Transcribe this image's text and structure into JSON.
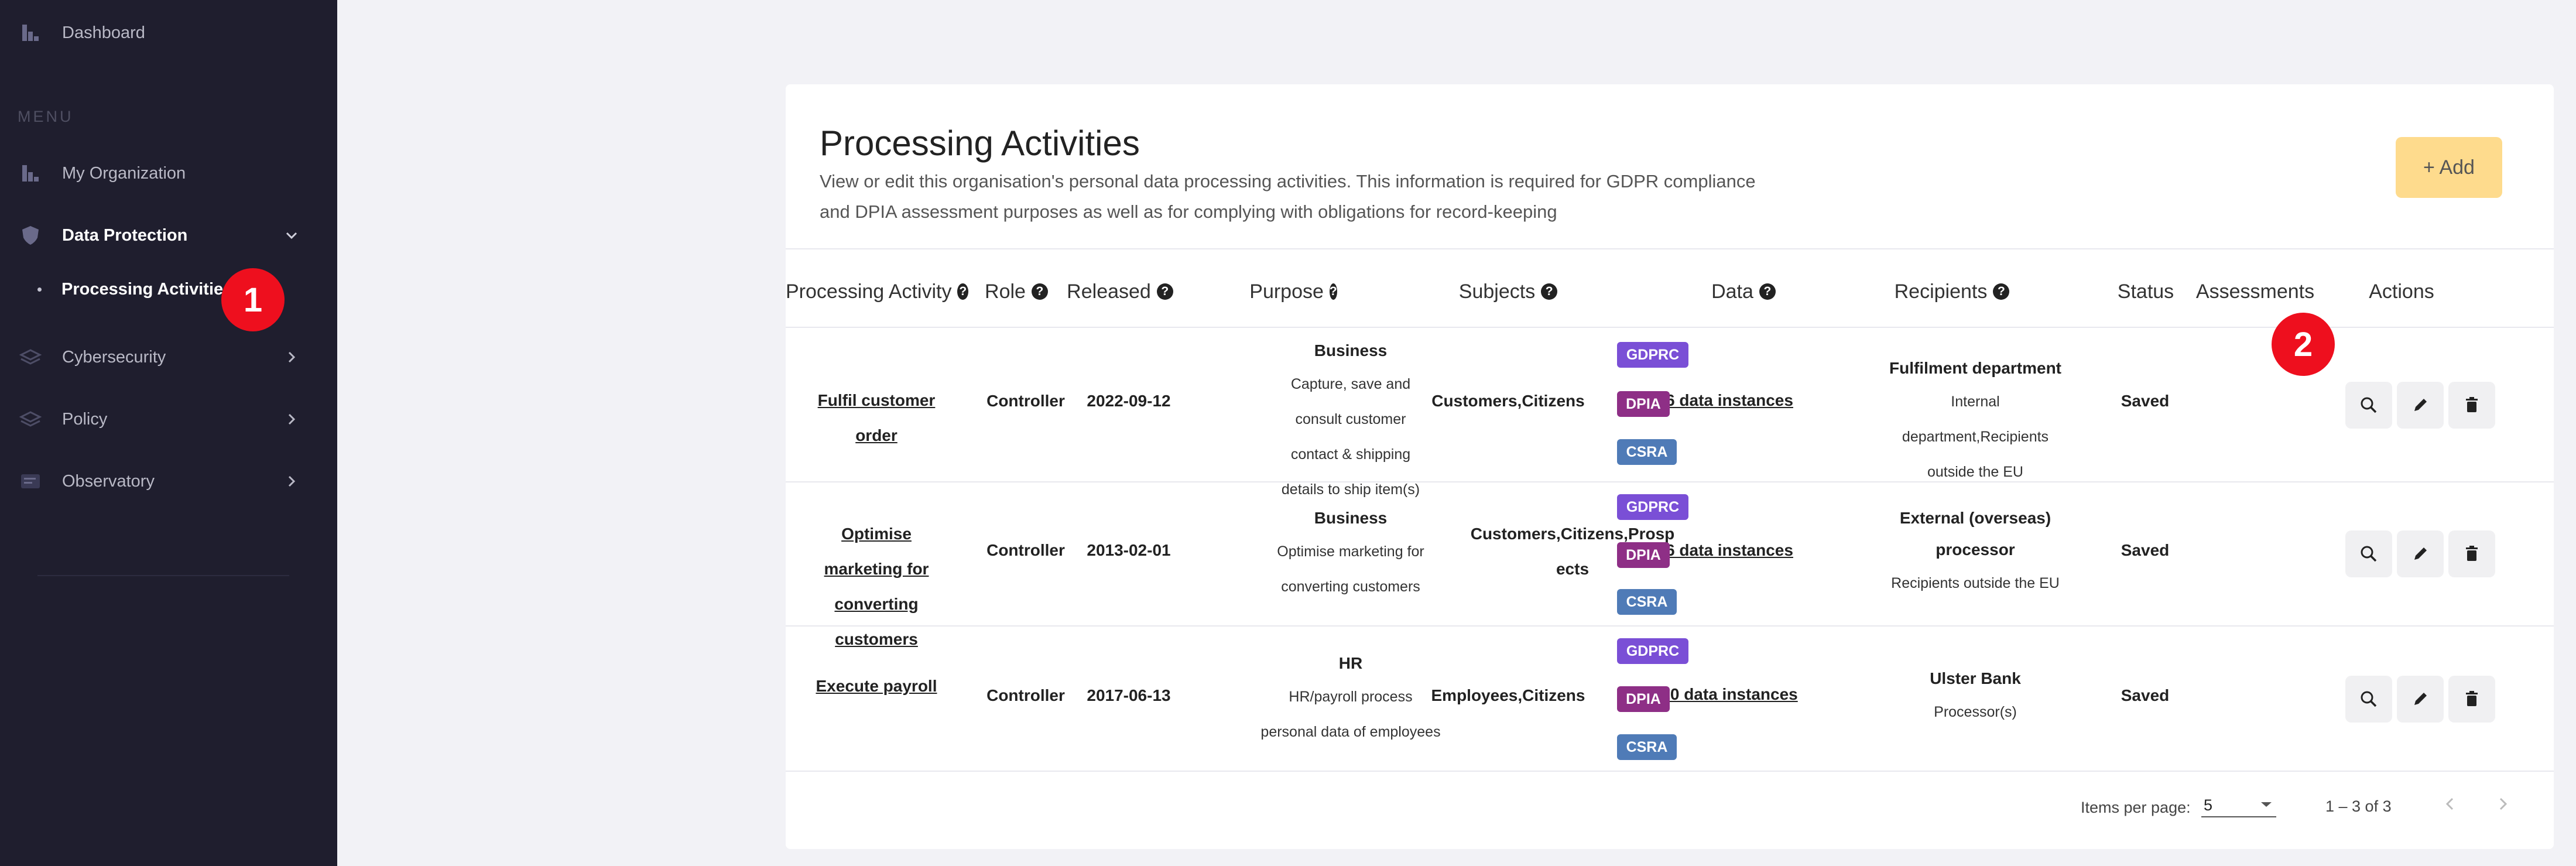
{
  "sidebar": {
    "dashboard": "Dashboard",
    "menu_label": "MENU",
    "items": [
      {
        "label": "My Organization"
      },
      {
        "label": "Data Protection"
      },
      {
        "label": "Cybersecurity"
      },
      {
        "label": "Policy"
      },
      {
        "label": "Observatory"
      }
    ],
    "sub_item": "Processing Activities"
  },
  "annotations": {
    "one": "1",
    "two": "2"
  },
  "page": {
    "title": "Processing Activities",
    "description": "View or edit this organisation's personal data processing activities. This information is required for GDPR compliance and DPIA assessment purposes as well as for complying with obligations for record-keeping",
    "add_label": "+ Add"
  },
  "table": {
    "headers": {
      "activity": "Processing Activity",
      "role": "Role",
      "released": "Released",
      "purpose": "Purpose",
      "subjects": "Subjects",
      "data": "Data",
      "recipients": "Recipients",
      "status": "Status",
      "assessments": "Assessments",
      "actions": "Actions"
    },
    "rows": [
      {
        "activity": "Fulfil customer order",
        "role": "Controller",
        "released": "2022-09-12",
        "purpose_title": "Business",
        "purpose_desc": "Capture, save and consult customer contact & shipping details to ship item(s)",
        "subjects": "Customers,Citizens",
        "data": "6 data instances",
        "recipients_title": "Fulfilment department",
        "recipients_desc": "Internal department,Recipients outside the EU",
        "status": "Saved",
        "tags": [
          "GDPRC",
          "DPIA",
          "CSRA"
        ]
      },
      {
        "activity": "Optimise marketing for converting customers",
        "role": "Controller",
        "released": "2013-02-01",
        "purpose_title": "Business",
        "purpose_desc": "Optimise marketing for converting customers",
        "subjects": "Customers,Citizens,Prospects",
        "data": "6 data instances",
        "recipients_title": "External (overseas) processor",
        "recipients_desc": "Recipients outside the EU",
        "status": "Saved",
        "tags": [
          "GDPRC",
          "DPIA",
          "CSRA"
        ]
      },
      {
        "activity": "Execute payroll",
        "role": "Controller",
        "released": "2017-06-13",
        "purpose_title": "HR",
        "purpose_desc": "HR/payroll process personal data of employees",
        "subjects": "Employees,Citizens",
        "data": "10 data instances",
        "recipients_title": "Ulster Bank",
        "recipients_desc": "Processor(s)",
        "status": "Saved",
        "tags": [
          "GDPRC",
          "DPIA",
          "CSRA"
        ]
      }
    ]
  },
  "pagination": {
    "items_per_page_label": "Items per page:",
    "items_per_page": "5",
    "range": "1 – 3 of 3"
  },
  "icons": [
    "dashboard-icon",
    "org-icon",
    "shield-icon",
    "layers-icon",
    "policy-icon",
    "observatory-icon",
    "search-icon",
    "edit-icon",
    "delete-icon"
  ],
  "colors": {
    "sidebar": "#1f1e2e",
    "gdprc": "#7a4fd6",
    "dpia": "#8e2f86",
    "csra": "#4f7bb7",
    "add": "#fedb8d",
    "marker": "#ee0f1e"
  }
}
